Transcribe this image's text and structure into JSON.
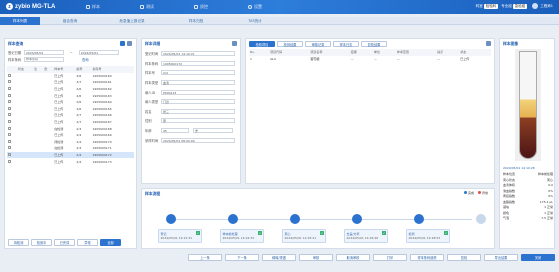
{
  "app": {
    "logo_text": "zybio MG-TLA",
    "user": "工程师1"
  },
  "topnav": [
    "样本",
    "测试",
    "质控",
    "设置"
  ],
  "topright": {
    "label1": "科室",
    "val1": "检验科",
    "label2": "专业组",
    "val2": "急检组"
  },
  "tabs": [
    "样本列表",
    "组合查询",
    "危急值上报记录",
    "样本归档",
    "TAT统计"
  ],
  "left": {
    "title": "样本查询",
    "date_label": "登记日期",
    "date_from": "2024/05/01",
    "date_to": "2024/05/01",
    "barcode_label": "样本条码",
    "barcode_placeholder": "样本条码",
    "query_label": "查询",
    "columns": [
      "状态",
      "急",
      "危",
      "样本号",
      "编号",
      "条码号"
    ],
    "rows": [
      [
        "",
        "",
        "",
        "已上传",
        "3/6",
        "1905000160"
      ],
      [
        "",
        "",
        "",
        "已上传",
        "3/7",
        "1905000161"
      ],
      [
        "",
        "",
        "",
        "已上传",
        "2/6",
        "1905000162"
      ],
      [
        "",
        "",
        "",
        "已上传",
        "2/6",
        "1905000163"
      ],
      [
        "",
        "",
        "",
        "已上传",
        "2/6",
        "1905000164"
      ],
      [
        "",
        "",
        "",
        "已上传",
        "2/6",
        "1905000165"
      ],
      [
        "",
        "",
        "",
        "已上传",
        "2/7",
        "1905000166"
      ],
      [
        "",
        "",
        "",
        "已上传",
        "2/7",
        "1905000167"
      ],
      [
        "",
        "",
        "",
        "在检测",
        "2/3",
        "1905000168"
      ],
      [
        "",
        "",
        "",
        "已上传",
        "2/4",
        "1905000169"
      ],
      [
        "",
        "",
        "",
        "待检测",
        "2/4",
        "1905000170"
      ],
      [
        "",
        "",
        "",
        "在检测",
        "2/3",
        "1905000171"
      ],
      [
        "",
        "",
        "",
        "已上传",
        "2/4",
        "1905000172"
      ],
      [
        "",
        "",
        "",
        "已上传",
        "2/4",
        "1905000173"
      ]
    ],
    "selected_row": 12,
    "bottom_tabs": [
      "待检测",
      "检测中",
      "已完成",
      "异常",
      "全部"
    ]
  },
  "mid": {
    "title": "样本详细",
    "fields": [
      {
        "label": "登记时间",
        "value": "2024/05/01 14:10:21"
      },
      {
        "label": "样本条码",
        "value": "1905000172"
      },
      {
        "label": "样本号",
        "value": "2/4"
      },
      {
        "label": "样本类型",
        "value": "血清"
      },
      {
        "label": "病人ID",
        "value": "P000123"
      },
      {
        "label": "病人类型",
        "value": "门诊"
      },
      {
        "label": "姓名",
        "value": "张三"
      },
      {
        "label": "性别",
        "value": "男"
      },
      {
        "label": "年龄",
        "value": "45"
      },
      {
        "label": "采样时间",
        "value": "2024/05/01 08:00:00"
      }
    ],
    "age_unit": "岁"
  },
  "right": {
    "tabs": [
      "检验项目",
      "检测结果",
      "审核记录",
      "样本日志",
      "复检结果"
    ],
    "columns": [
      "No.",
      "项目代码",
      "项目名称",
      "结果",
      "单位",
      "参考范围",
      "提示",
      "状态"
    ],
    "rows": [
      [
        "1",
        "GLU",
        "葡萄糖",
        "—",
        "—",
        "—",
        "—",
        "已上传"
      ]
    ]
  },
  "tube": {
    "title": "样本图像",
    "time": "2024/05/01 14:10:28",
    "rows": [
      {
        "k": "样本位置",
        "v": "样本前处理"
      },
      {
        "k": "离心状态",
        "v": "离心"
      },
      {
        "k": "血清体积",
        "v": "0.0"
      },
      {
        "k": "溶血指数",
        "v": "0%"
      },
      {
        "k": "黄疸指数",
        "v": "0%"
      },
      {
        "k": "血脂指数",
        "v": "175.1 μL"
      },
      {
        "k": "凝块",
        "v": "1 正常"
      },
      {
        "k": "颜色",
        "v": "1 正常"
      },
      {
        "k": "气泡",
        "v": "7.5 正常"
      }
    ]
  },
  "timeline": {
    "title": "样本流程",
    "legend": [
      "完成",
      "异常"
    ],
    "steps": [
      {
        "name": "登记",
        "time": "2024/05/01 14:21:31",
        "user": "工程师1"
      },
      {
        "name": "样本前处理",
        "time": "2024/05/01 14:22:33",
        "user": ""
      },
      {
        "name": "离心",
        "time": "2024/05/01 14:25:21",
        "user": ""
      },
      {
        "name": "去盖/分杯",
        "time": "2024/05/01 14:26:26",
        "user": ""
      },
      {
        "name": "检测",
        "time": "2024/05/01 14:28:53",
        "user": ""
      },
      {
        "name": "归档",
        "time": "",
        "user": ""
      }
    ]
  },
  "bottom": [
    "上一条",
    "下一条",
    "稀释/重做",
    "审核",
    "取消审核",
    "打印",
    "样本条码追踪",
    "复检",
    "导出结果",
    "关闭"
  ]
}
